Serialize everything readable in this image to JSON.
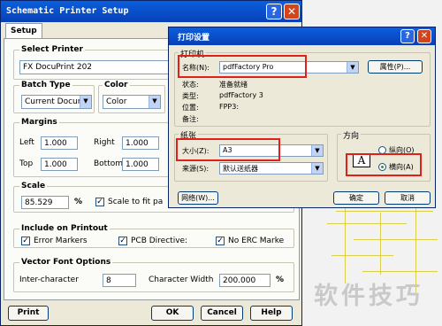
{
  "schematic": {
    "title": "Schematic Printer Setup",
    "tab": "Setup",
    "select_printer": {
      "label": "Select Printer",
      "value": "FX DocuPrint 202"
    },
    "batch_type": {
      "label": "Batch Type",
      "value": "Current Docum"
    },
    "color": {
      "label": "Color",
      "value": "Color"
    },
    "margins": {
      "label": "Margins",
      "left_label": "Left",
      "left": "1.000",
      "right_label": "Right",
      "right": "1.000",
      "top_label": "Top",
      "top": "1.000",
      "bottom_label": "Bottom",
      "bottom": "1.000"
    },
    "scale": {
      "label": "Scale",
      "value": "85.529",
      "unit": "%",
      "fit_label": "Scale to fit pa"
    },
    "include": {
      "label": "Include on Printout",
      "error_markers": "Error Markers",
      "pcb_directives": "PCB Directive:",
      "no_erc": "No ERC Marke"
    },
    "vector_font": {
      "label": "Vector Font Options",
      "inter_label": "Inter-character",
      "inter_value": "8",
      "width_label": "Character Width",
      "width_value": "200.000",
      "width_unit": "%"
    },
    "buttons": {
      "print": "Print",
      "ok": "OK",
      "cancel": "Cancel",
      "help": "Help"
    }
  },
  "print_setup": {
    "title": "打印设置",
    "printer_group": "打印机",
    "name_label": "名称(N):",
    "name_value": "pdfFactory Pro",
    "properties": "属性(P)...",
    "status_label": "状态:",
    "status_value": "准备就绪",
    "type_label": "类型:",
    "type_value": "pdfFactory 3",
    "where_label": "位置:",
    "where_value": "FPP3:",
    "comment_label": "备注:",
    "paper_group": "纸张",
    "size_label": "大小(Z):",
    "size_value": "A3",
    "source_label": "来源(S):",
    "source_value": "默认送纸器",
    "orientation_group": "方向",
    "portrait": "纵向(O)",
    "landscape": "横向(A)",
    "orient_icon": "A",
    "network": "网络(W)...",
    "ok": "确定",
    "cancel": "取消"
  },
  "watermark": "软件技巧"
}
